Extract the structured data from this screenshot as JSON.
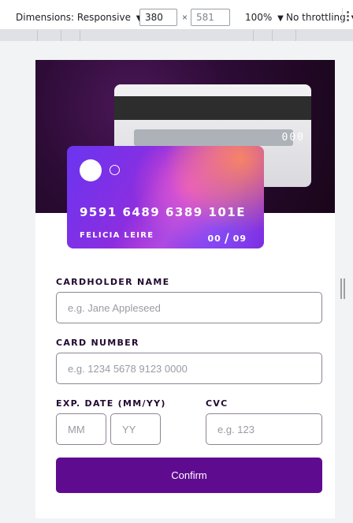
{
  "toolbar": {
    "dimensions_label": "Dimensions: Responsive",
    "dimensions_caret": "▼",
    "width": "380",
    "times": "×",
    "height": "581",
    "zoom": "100%",
    "zoom_caret": "▼",
    "throttling": "No throttling",
    "throttling_caret": "▼"
  },
  "card_back": {
    "cvc": "000"
  },
  "card_front": {
    "number": "9591 6489 6389 101E",
    "holder": "FELICIA LEIRE",
    "exp_month": "00",
    "exp_sep": "/",
    "exp_year": "09"
  },
  "form": {
    "name_label": "CARDHOLDER NAME",
    "name_placeholder": "e.g. Jane Appleseed",
    "number_label": "CARD NUMBER",
    "number_placeholder": "e.g. 1234 5678 9123 0000",
    "exp_label": "EXP. DATE (MM/YY)",
    "mm_placeholder": "MM",
    "yy_placeholder": "YY",
    "cvc_label": "CVC",
    "cvc_placeholder": "e.g. 123",
    "confirm_label": "Confirm"
  },
  "colors": {
    "accent": "#5f0b8f",
    "text_dark": "#21092f",
    "hero_bg": "#2b0b34"
  }
}
